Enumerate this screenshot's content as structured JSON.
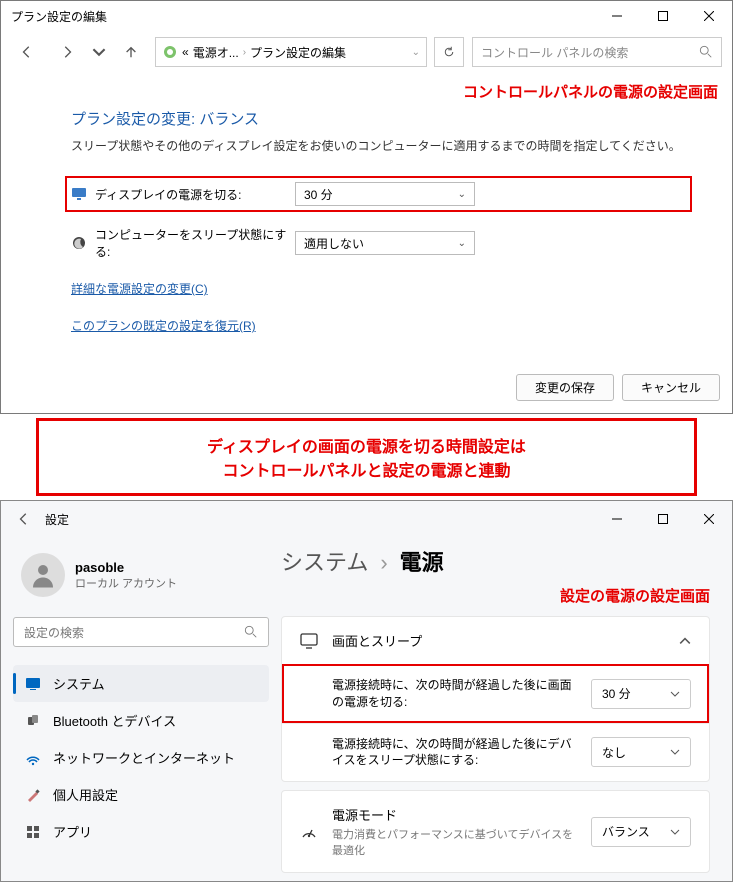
{
  "cp": {
    "windowTitle": "プラン設定の編集",
    "breadcrumb1": "電源オ...",
    "breadcrumb2": "プラン設定の編集",
    "searchPlaceholder": "コントロール パネルの検索",
    "annotation": "コントロールパネルの電源の設定画面",
    "heading": "プラン設定の変更: バランス",
    "description": "スリープ状態やその他のディスプレイ設定をお使いのコンピューターに適用するまでの時間を指定してください。",
    "displayLabel": "ディスプレイの電源を切る:",
    "displayValue": "30 分",
    "sleepLabel": "コンピューターをスリープ状態にする:",
    "sleepValue": "適用しない",
    "advancedLink": "詳細な電源設定の変更(C)",
    "restoreLink": "このプランの既定の設定を復元(R)",
    "saveBtn": "変更の保存",
    "cancelBtn": "キャンセル"
  },
  "annoBox": {
    "line1": "ディスプレイの画面の電源を切る時間設定は",
    "line2": "コントロールパネルと設定の電源と連動"
  },
  "settings": {
    "windowTitle": "設定",
    "profileName": "pasoble",
    "profileAcct": "ローカル アカウント",
    "searchPlaceholder": "設定の検索",
    "nav": {
      "system": "システム",
      "bluetooth": "Bluetooth とデバイス",
      "network": "ネットワークとインターネット",
      "personalize": "個人用設定",
      "apps": "アプリ"
    },
    "crumb1": "システム",
    "crumb2": "電源",
    "annotation": "設定の電源の設定画面",
    "section1": "画面とスリープ",
    "row1Label": "電源接続時に、次の時間が経過した後に画面の電源を切る:",
    "row1Value": "30 分",
    "row2Label": "電源接続時に、次の時間が経過した後にデバイスをスリープ状態にする:",
    "row2Value": "なし",
    "powerModeTitle": "電源モード",
    "powerModeDesc": "電力消費とパフォーマンスに基づいてデバイスを最適化",
    "powerModeValue": "バランス"
  }
}
